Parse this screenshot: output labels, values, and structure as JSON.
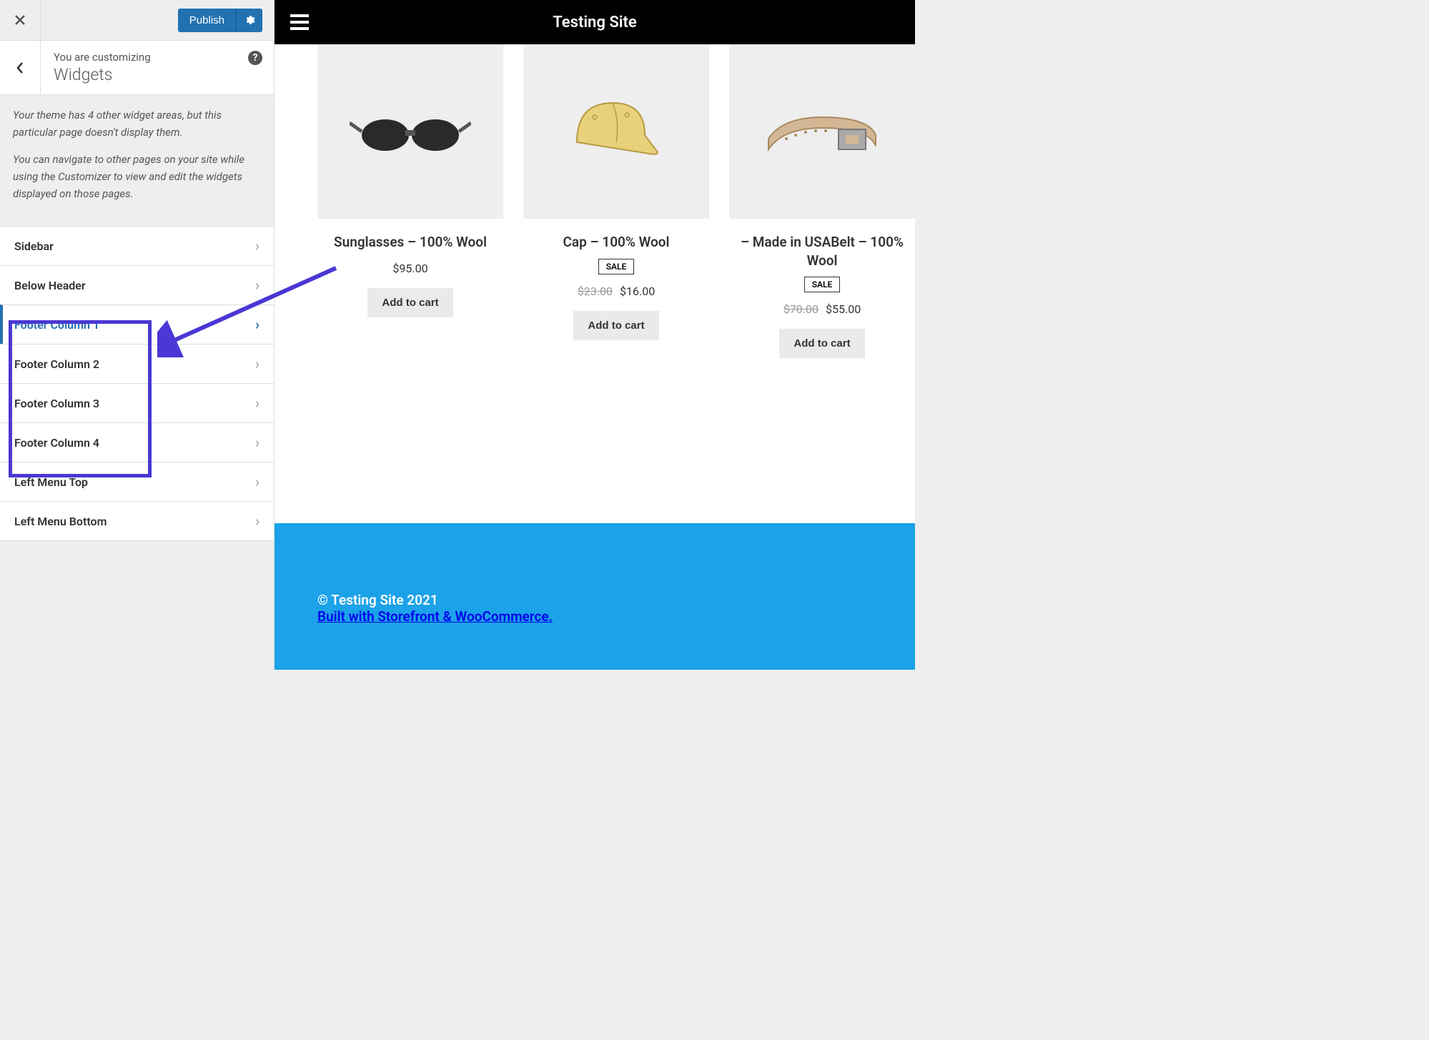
{
  "customizer": {
    "publish_label": "Publish",
    "back_aria": "Back",
    "subheading": "You are customizing",
    "title": "Widgets",
    "info_p1": "Your theme has 4 other widget areas, but this particular page doesn't display them.",
    "info_p2": "You can navigate to other pages on your site while using the Customizer to view and edit the widgets displayed on those pages.",
    "items": [
      {
        "label": "Sidebar"
      },
      {
        "label": "Below Header"
      },
      {
        "label": "Footer Column 1",
        "active": true
      },
      {
        "label": "Footer Column 2"
      },
      {
        "label": "Footer Column 3"
      },
      {
        "label": "Footer Column 4"
      },
      {
        "label": "Left Menu Top"
      },
      {
        "label": "Left Menu Bottom"
      }
    ]
  },
  "site": {
    "title": "Testing Site",
    "footer_copyright": "© Testing Site 2021",
    "footer_credit": "Built with Storefront & WooCommerce"
  },
  "products": [
    {
      "name": "Sunglasses – 100% Wool",
      "price": "$95.00",
      "old_price": "",
      "sale": false,
      "cta": "Add to cart",
      "icon": "sunglasses"
    },
    {
      "name": "Cap – 100% Wool",
      "price": "$16.00",
      "old_price": "$23.00",
      "sale": true,
      "sale_label": "SALE",
      "cta": "Add to cart",
      "icon": "cap"
    },
    {
      "name": "– Made in USABelt – 100% Wool",
      "price": "$55.00",
      "old_price": "$70.00",
      "sale": true,
      "sale_label": "SALE",
      "cta": "Add to cart",
      "icon": "belt"
    }
  ]
}
